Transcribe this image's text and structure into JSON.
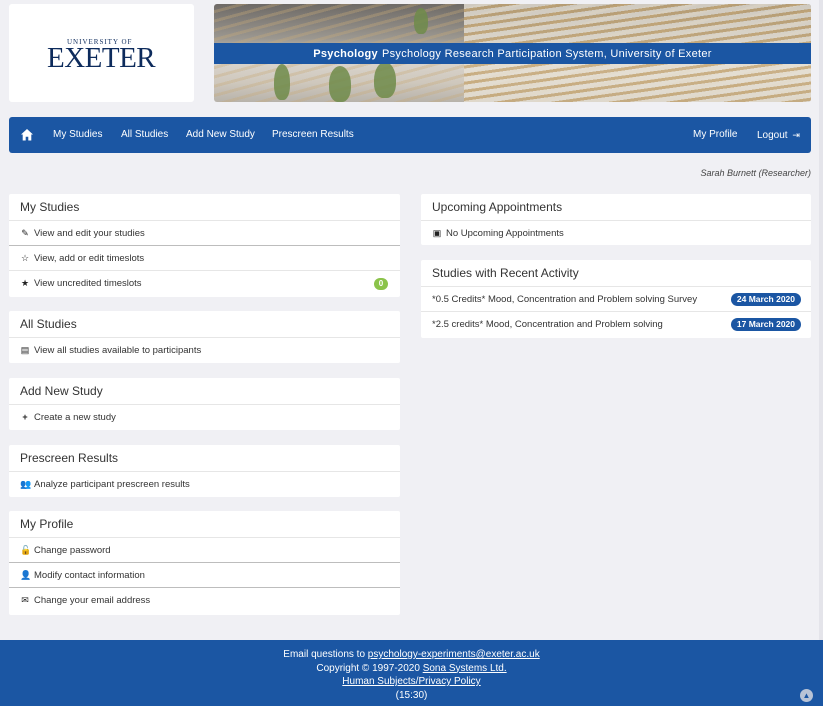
{
  "header": {
    "logo_top": "UNIVERSITY OF",
    "logo_big": "EXETER",
    "banner_bold": "Psychology",
    "banner_text": "Psychology Research Participation System, University of Exeter"
  },
  "nav": {
    "home_icon": "home-icon",
    "items": [
      "My Studies",
      "All Studies",
      "Add New Study",
      "Prescreen Results"
    ],
    "my_profile": "My Profile",
    "logout": "Logout"
  },
  "user": {
    "label": "Sarah Burnett (Researcher)"
  },
  "my_studies": {
    "title": "My Studies",
    "rows": [
      "View and edit your studies",
      "View, add or edit timeslots",
      "View uncredited timeslots"
    ],
    "uncredited_count": "0"
  },
  "all_studies": {
    "title": "All Studies",
    "rows": [
      "View all studies available to participants"
    ]
  },
  "add_new_study": {
    "title": "Add New Study",
    "rows": [
      "Create a new study"
    ]
  },
  "prescreen_results": {
    "title": "Prescreen Results",
    "rows": [
      "Analyze participant prescreen results"
    ]
  },
  "my_profile": {
    "title": "My Profile",
    "rows": [
      "Change password",
      "Modify contact information",
      "Change your email address"
    ]
  },
  "appointments": {
    "title": "Upcoming Appointments",
    "empty": "No Upcoming Appointments"
  },
  "recent": {
    "title": "Studies with Recent Activity",
    "items": [
      {
        "name": "*0.5 Credits* Mood, Concentration and Problem solving Survey",
        "date": "24 March 2020"
      },
      {
        "name": "*2.5 credits* Mood, Concentration and Problem solving",
        "date": "17 March 2020"
      }
    ]
  },
  "footer": {
    "email_prefix": "Email questions to",
    "email": "psychology-experiments@exeter.ac.uk",
    "copyright_prefix": "Copyright © 1997-2020",
    "company": "Sona Systems Ltd.",
    "policy": "Human Subjects/Privacy Policy",
    "time": "(15:30)"
  },
  "colors": {
    "brand": "#1b56a3",
    "badge_green": "#8bc34a",
    "background": "#f0f0f4"
  }
}
